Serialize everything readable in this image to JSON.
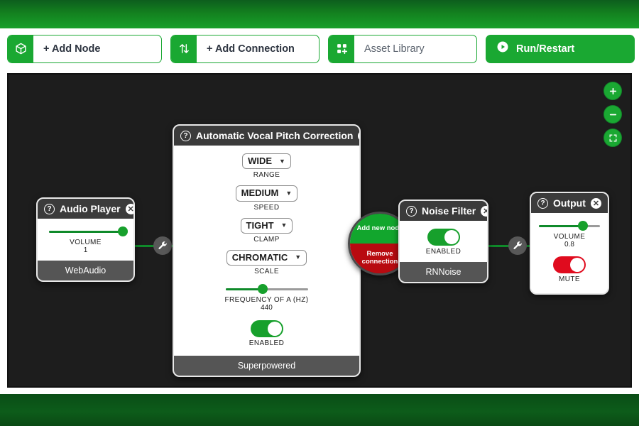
{
  "toolbar": {
    "add_node": {
      "label": "+ Add Node",
      "icon": "cube-icon"
    },
    "add_connection": {
      "label": "+ Add Connection",
      "icon": "arrows-updown-icon"
    },
    "asset_library": {
      "label": "Asset Library",
      "icon": "grid-plus-icon"
    },
    "run": {
      "label": "Run/Restart",
      "icon": "play-icon"
    }
  },
  "zoom_controls": {
    "zoom_in": "+",
    "zoom_out": "−",
    "fit": "fit-screen-icon"
  },
  "nodes": {
    "audio_player": {
      "title": "Audio Player",
      "footer": "WebAudio",
      "volume": {
        "label": "VOLUME",
        "value": "1",
        "percent": 100
      }
    },
    "pitch_correction": {
      "title": "Automatic Vocal Pitch Correction",
      "footer": "Superpowered",
      "range": {
        "label": "RANGE",
        "value": "WIDE"
      },
      "speed": {
        "label": "SPEED",
        "value": "MEDIUM"
      },
      "clamp": {
        "label": "CLAMP",
        "value": "TIGHT"
      },
      "scale": {
        "label": "SCALE",
        "value": "CHROMATIC"
      },
      "frequency": {
        "label": "FREQUENCY OF A (HZ)",
        "value": "440",
        "percent": 45
      },
      "enabled": {
        "label": "ENABLED",
        "state": "on"
      }
    },
    "noise_filter": {
      "title": "Noise Filter",
      "footer": "RNNoise",
      "enabled": {
        "label": "ENABLED",
        "state": "on"
      }
    },
    "output": {
      "title": "Output",
      "volume": {
        "label": "VOLUME",
        "value": "0.8",
        "percent": 72
      },
      "mute": {
        "label": "MUTE",
        "state": "on"
      }
    }
  },
  "radial_menu": {
    "add_new_node": "Add new node",
    "remove_connection": "Remove connection"
  },
  "colors": {
    "brand_green": "#1aa832",
    "wire_green": "#0f8a2a",
    "danger_red": "#b80a10",
    "canvas": "#1d1d1d"
  }
}
